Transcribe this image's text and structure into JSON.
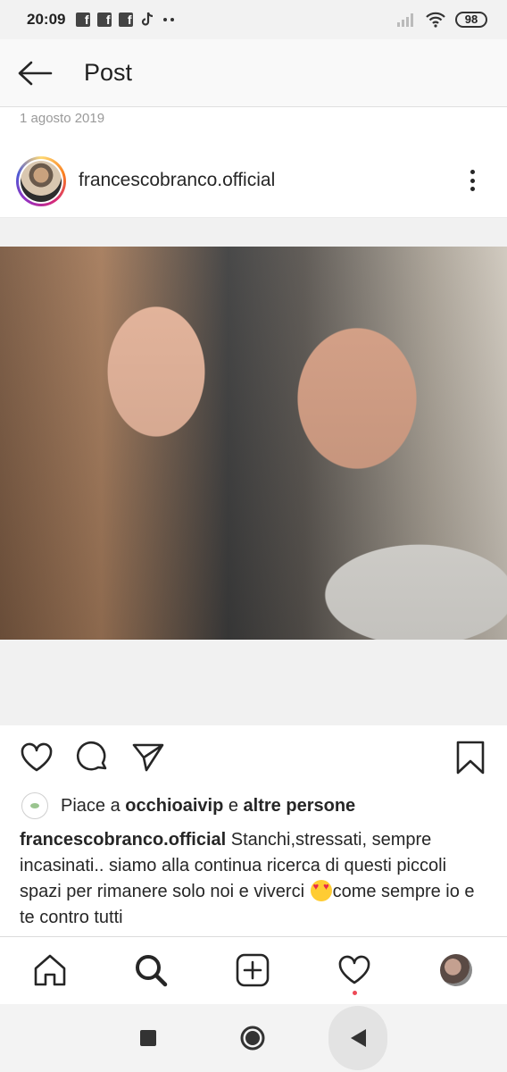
{
  "status_bar": {
    "time": "20:09",
    "battery": "98",
    "icons": [
      "facebook-icon",
      "facebook-icon",
      "facebook-icon",
      "tiktok-icon",
      "more-dots-icon",
      "signal-icon",
      "wifi-icon",
      "battery-icon"
    ]
  },
  "top_bar": {
    "title": "Post",
    "back_icon": "arrow-left-icon"
  },
  "post": {
    "date": "1 agosto 2019",
    "username": "francescobranco.official",
    "more_icon": "vertical-dots-icon",
    "likes": {
      "prefix": "Piace a ",
      "user": "occhioaivip",
      "middle": " e ",
      "others": "altre persone"
    },
    "caption": {
      "username": "francescobranco.official",
      "text_before_emoji": " Stanchi,stressati, sempre incasinati.. siamo alla continua ricerca di questi piccoli spazi per rimanere solo noi e viverci ",
      "emoji": "heart-eyes-emoji",
      "text_after_emoji": "come sempre io e te contro tutti"
    }
  },
  "actions": [
    "heart-icon",
    "comment-icon",
    "share-icon",
    "bookmark-icon"
  ],
  "bottom_nav": [
    "home-icon",
    "search-icon",
    "add-post-icon",
    "activity-heart-icon",
    "profile-avatar"
  ],
  "system_nav": [
    "square-recents-icon",
    "circle-home-icon",
    "triangle-back-icon"
  ],
  "colors": {
    "text": "#262626",
    "muted": "#9a9a9a",
    "notification_dot": "#ed4956",
    "status_bar_bg": "#f2f2f2"
  }
}
